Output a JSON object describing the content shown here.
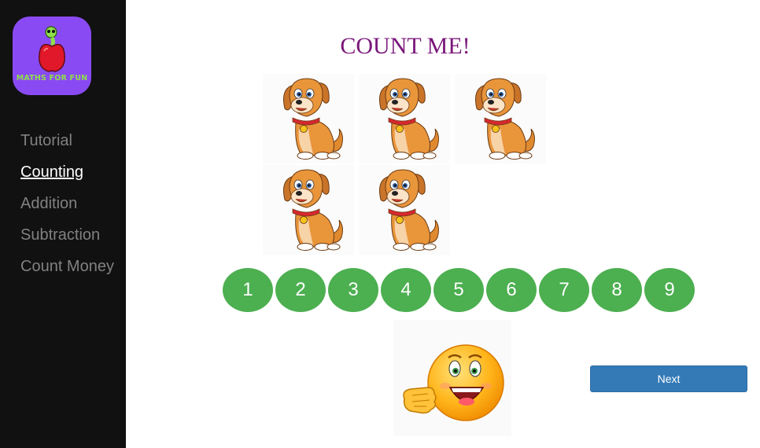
{
  "app": {
    "logo_text": "MATHS FOR FUN"
  },
  "sidebar": {
    "items": [
      {
        "label": "Tutorial",
        "active": false
      },
      {
        "label": "Counting",
        "active": true
      },
      {
        "label": "Addition",
        "active": false
      },
      {
        "label": "Subtraction",
        "active": false
      },
      {
        "label": "Count Money",
        "active": false
      }
    ]
  },
  "main": {
    "title": "COUNT ME!",
    "dog_count": 5,
    "number_buttons": [
      "1",
      "2",
      "3",
      "4",
      "5",
      "6",
      "7",
      "8",
      "9"
    ],
    "next_label": "Next",
    "feedback_icon": "happy-emoji-icon"
  },
  "colors": {
    "sidebar_bg": "#111111",
    "logo_bg": "#8a4af3",
    "title": "#7a177a",
    "number_button": "#4caf50",
    "next_button": "#337ab7"
  }
}
